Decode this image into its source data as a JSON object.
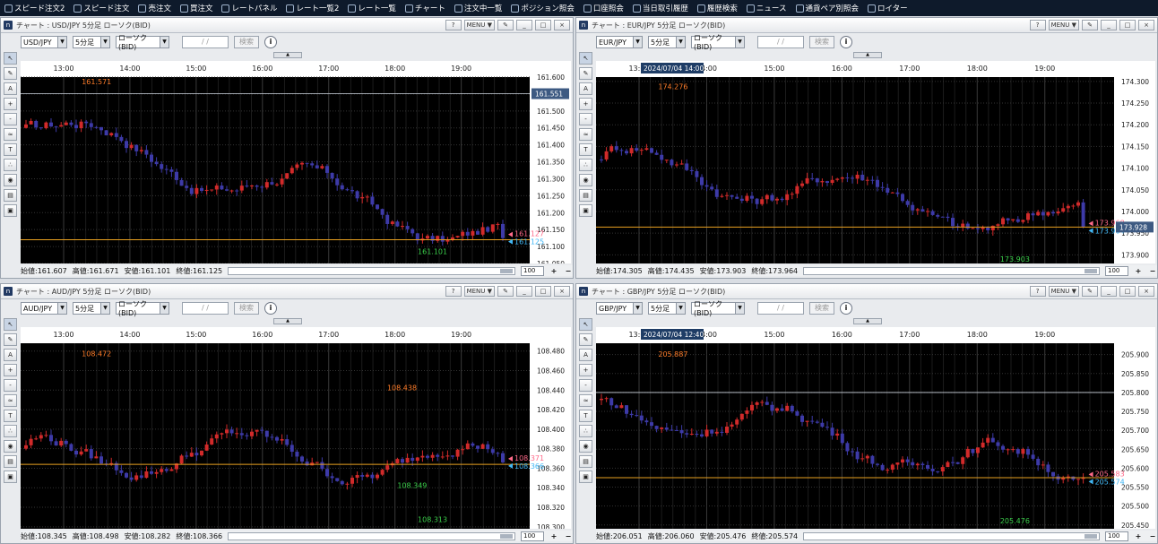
{
  "toolbar": [
    {
      "label": "スピード注文2",
      "icon": "speed-order-2-icon"
    },
    {
      "label": "スピード注文",
      "icon": "speed-order-icon"
    },
    {
      "label": "売注文",
      "icon": "sell-order-icon"
    },
    {
      "label": "買注文",
      "icon": "buy-order-icon"
    },
    {
      "label": "レートパネル",
      "icon": "rate-panel-icon"
    },
    {
      "label": "レート一覧2",
      "icon": "rate-list-2-icon"
    },
    {
      "label": "レート一覧",
      "icon": "rate-list-icon"
    },
    {
      "label": "チャート",
      "icon": "chart-icon"
    },
    {
      "label": "注文中一覧",
      "icon": "orders-icon"
    },
    {
      "label": "ポジション照会",
      "icon": "position-icon"
    },
    {
      "label": "口座照会",
      "icon": "account-icon"
    },
    {
      "label": "当日取引履歴",
      "icon": "today-history-icon"
    },
    {
      "label": "履歴検索",
      "icon": "history-search-icon"
    },
    {
      "label": "ニュース",
      "icon": "news-icon"
    },
    {
      "label": "通貨ペア別照会",
      "icon": "pair-inquiry-icon"
    },
    {
      "label": "ロイター",
      "icon": "reuters-icon"
    }
  ],
  "win_buttons": [
    "?",
    "MENU ▼",
    "✎",
    "_",
    "□",
    "×"
  ],
  "controls": {
    "timeframe": "5分足",
    "chart_kind": "ローソク(BID)",
    "date_placeholder": "/ /",
    "search": "検索",
    "info": "i"
  },
  "time_labels": [
    "13:00",
    "14:00",
    "15:00",
    "16:00",
    "17:00",
    "18:00",
    "19:00"
  ],
  "colors": {
    "up": "#d12a2a",
    "down": "#3d3aa8",
    "bg": "#000000",
    "grid": "#2f2f2f",
    "line": "#e8a020",
    "ask_tag": "#ff6a8a",
    "bid_tag": "#41b7f5",
    "high_label": "#ff7d2a",
    "low_label": "#3bcf4b"
  },
  "panels": [
    {
      "title": "チャート : USD/JPY 5分足 ローソク(BID)",
      "pair": "USD/JPY",
      "y_ticks": [
        "161.600",
        "161.550",
        "161.500",
        "161.450",
        "161.400",
        "161.350",
        "161.300",
        "161.250",
        "161.200",
        "161.150",
        "161.100",
        "161.050"
      ],
      "ylim": [
        161.05,
        161.6
      ],
      "price_tag": "161.551",
      "crosshair_label": "",
      "high_label": "161.571",
      "low_label": "161.101",
      "last_ask": "161.127",
      "last_bid": "161.125",
      "status": {
        "open": "始値:161.607",
        "high": "高値:161.671",
        "low": "安値:161.101",
        "close": "終値:161.125",
        "zoom": "100"
      },
      "chart_data": {
        "type": "candlestick",
        "start": 161.45,
        "end": 161.125,
        "high": 161.571,
        "low": 161.101,
        "hline": 161.12,
        "crossline": 161.551
      }
    },
    {
      "title": "チャート : EUR/JPY 5分足 ローソク(BID)",
      "pair": "EUR/JPY",
      "y_ticks": [
        "174.300",
        "174.250",
        "174.200",
        "174.150",
        "174.100",
        "174.050",
        "174.000",
        "173.950",
        "173.900"
      ],
      "ylim": [
        173.88,
        174.31
      ],
      "price_tag": "173.928",
      "crosshair_label": "2024/07/04 14:00",
      "high_label": "174.276",
      "low_label": "173.903",
      "last_ask": "173.968",
      "last_bid": "173.964",
      "status": {
        "open": "始値:174.305",
        "high": "高値:174.435",
        "low": "安値:173.903",
        "close": "終値:173.964",
        "zoom": "100"
      },
      "chart_data": {
        "type": "candlestick",
        "start": 174.12,
        "end": 173.964,
        "high": 174.276,
        "low": 173.903,
        "hline": 173.964,
        "crossline": null
      }
    },
    {
      "title": "チャート : AUD/JPY 5分足 ローソク(BID)",
      "pair": "AUD/JPY",
      "y_ticks": [
        "108.480",
        "108.460",
        "108.440",
        "108.420",
        "108.400",
        "108.380",
        "108.360",
        "108.340",
        "108.320",
        "108.300"
      ],
      "ylim": [
        108.298,
        108.488
      ],
      "price_tag": "",
      "crosshair_label": "",
      "high_label": "108.472",
      "high_label2": "108.438",
      "low_label": "108.313",
      "low_label2": "108.349",
      "last_ask": "108.371",
      "last_bid": "108.366",
      "status": {
        "open": "始値:108.345",
        "high": "高値:108.498",
        "low": "安値:108.282",
        "close": "終値:108.366",
        "zoom": "100"
      },
      "chart_data": {
        "type": "candlestick",
        "start": 108.38,
        "end": 108.366,
        "high": 108.472,
        "low": 108.313,
        "hline": 108.364,
        "crossline": null
      }
    },
    {
      "title": "チャート : GBP/JPY 5分足 ローソク(BID)",
      "pair": "GBP/JPY",
      "y_ticks": [
        "205.900",
        "205.850",
        "205.800",
        "205.750",
        "205.700",
        "205.650",
        "205.600",
        "205.550",
        "205.500",
        "205.450"
      ],
      "ylim": [
        205.44,
        205.93
      ],
      "price_tag": "",
      "crosshair_label": "2024/07/04 12:40",
      "high_label": "205.887",
      "low_label": "205.476",
      "last_ask": "205.583",
      "last_bid": "205.574",
      "status": {
        "open": "始値:206.051",
        "high": "高値:206.060",
        "low": "安値:205.476",
        "close": "終値:205.574",
        "zoom": "100"
      },
      "chart_data": {
        "type": "candlestick",
        "start": 205.78,
        "end": 205.574,
        "high": 205.887,
        "low": 205.476,
        "hline": 205.575,
        "crossline": 205.8
      }
    }
  ]
}
